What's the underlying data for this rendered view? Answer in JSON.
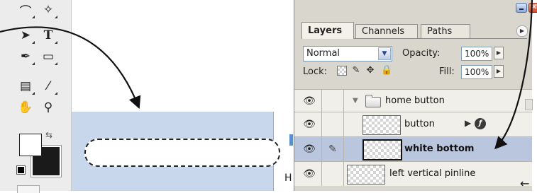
{
  "toolbar": {
    "tools": [
      {
        "icon": "lasso-icon",
        "glyph": "⌒"
      },
      {
        "icon": "magic-wand-icon",
        "glyph": "✧"
      },
      {
        "icon": "path-selection-icon",
        "glyph": "➤"
      },
      {
        "icon": "type-tool-icon",
        "glyph": "T"
      },
      {
        "icon": "pen-tool-icon",
        "glyph": "✒"
      },
      {
        "icon": "rectangle-shape-icon",
        "glyph": "▭"
      },
      {
        "icon": "notes-tool-icon",
        "glyph": "▤"
      },
      {
        "icon": "eyedropper-icon",
        "glyph": "⁄"
      },
      {
        "icon": "hand-tool-icon",
        "glyph": "✋"
      },
      {
        "icon": "zoom-tool-icon",
        "glyph": "⚲"
      }
    ],
    "foreground_color": "#ffffff",
    "background_color": "#1a1a1a"
  },
  "canvas": {
    "selection_fill": "#c9d7ec",
    "marker_color": "#5b8fd0",
    "edge_label": "H"
  },
  "layers_panel": {
    "tabs": [
      {
        "label": "Layers",
        "active": true
      },
      {
        "label": "Channels",
        "active": false
      },
      {
        "label": "Paths",
        "active": false
      }
    ],
    "blend_mode": "Normal",
    "opacity_label": "Opacity:",
    "opacity_value": "100%",
    "lock_label": "Lock:",
    "fill_label": "Fill:",
    "fill_value": "100%",
    "layers": [
      {
        "name": "home button",
        "type": "group",
        "visible": true,
        "expanded": true
      },
      {
        "name": "button",
        "type": "layer",
        "visible": true,
        "has_effects": true,
        "fx_glyph": "ƒ"
      },
      {
        "name": "white bottom",
        "type": "layer",
        "visible": true,
        "selected": true,
        "linked_brush": true
      },
      {
        "name": "left vertical pinline",
        "type": "layer",
        "visible": true
      }
    ]
  },
  "window": {
    "minimize_glyph": "",
    "close_glyph": "✕"
  },
  "annotations": {
    "bottom_right_arrow": "←"
  }
}
